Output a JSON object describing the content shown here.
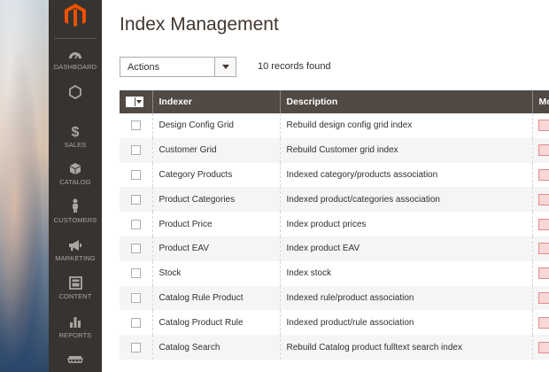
{
  "sidebar": {
    "items": [
      {
        "label": "DASHBOARD",
        "icon": "dashboard-gauge-icon"
      },
      {
        "label": "",
        "icon": "hexagon-icon"
      },
      {
        "label": "SALES",
        "icon": "dollar-icon"
      },
      {
        "label": "CATALOG",
        "icon": "cube-icon"
      },
      {
        "label": "CUSTOMERS",
        "icon": "person-icon"
      },
      {
        "label": "MARKETING",
        "icon": "megaphone-icon"
      },
      {
        "label": "CONTENT",
        "icon": "content-layout-icon"
      },
      {
        "label": "REPORTS",
        "icon": "bar-chart-icon"
      },
      {
        "label": "",
        "icon": "store-awning-icon"
      }
    ]
  },
  "page": {
    "title": "Index Management"
  },
  "toolbar": {
    "actions_label": "Actions",
    "records_found": "10 records found"
  },
  "grid": {
    "columns": [
      "Indexer",
      "Description",
      "Mo"
    ],
    "rows": [
      {
        "indexer": "Design Config Grid",
        "description": "Rebuild design config grid index"
      },
      {
        "indexer": "Customer Grid",
        "description": "Rebuild Customer grid index"
      },
      {
        "indexer": "Category Products",
        "description": "Indexed category/products association"
      },
      {
        "indexer": "Product Categories",
        "description": "Indexed product/categories association"
      },
      {
        "indexer": "Product Price",
        "description": "Index product prices"
      },
      {
        "indexer": "Product EAV",
        "description": "Index product EAV"
      },
      {
        "indexer": "Stock",
        "description": "Index stock"
      },
      {
        "indexer": "Catalog Rule Product",
        "description": "Indexed rule/product association"
      },
      {
        "indexer": "Catalog Product Rule",
        "description": "Indexed product/rule association"
      },
      {
        "indexer": "Catalog Search",
        "description": "Rebuild Catalog product fulltext search index"
      }
    ]
  },
  "colors": {
    "sidebar_bg": "#373330",
    "header_bg": "#514943",
    "logo_orange": "#eb5202",
    "mode_swatch": "#fad7d7"
  }
}
